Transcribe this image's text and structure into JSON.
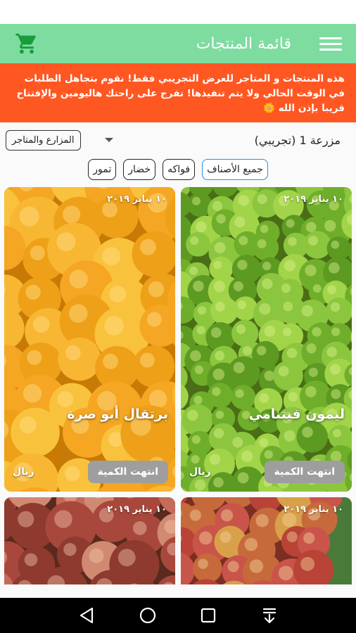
{
  "app_bar": {
    "title": "قائمة المنتجات",
    "cart_icon": "shopping-cart-icon",
    "menu_icon": "hamburger-menu-icon"
  },
  "banner": {
    "text": "هذه المنتجات و المتاجر للعرض التجريبي فقط! نقوم بتجاهل الطلبات في الوقت الحالي ولا يتم تنفيذها! تفرج على راحتك هاليومين والإفتتاح قريبا بإذن الله 🌼",
    "color": "#ff5722"
  },
  "filter": {
    "selected_farm": "مزرعة 1 (تجريبي)",
    "dropdown_label": "المزارع والمتاجر"
  },
  "categories": [
    {
      "label": "جميع الأصناف",
      "active": true
    },
    {
      "label": "فواكه",
      "active": false
    },
    {
      "label": "خضار",
      "active": false
    },
    {
      "label": "تمور",
      "active": false
    }
  ],
  "products": [
    {
      "name": "ليمون فيتنامي",
      "date": "١٠ يناير ٢٠١٩",
      "status": "انتهت الكمية",
      "currency": "ريال",
      "kind": "lime"
    },
    {
      "name": "برتقال أبو صرة",
      "date": "١٠ يناير ٢٠١٩",
      "status": "انتهت الكمية",
      "currency": "ريال",
      "kind": "orange"
    },
    {
      "name": "",
      "date": "١٠ يناير ٢٠١٩",
      "status": "",
      "currency": "",
      "kind": "apple"
    },
    {
      "name": "",
      "date": "١٠ يناير ٢٠١٩",
      "status": "",
      "currency": "",
      "kind": "pomegranate"
    }
  ],
  "nav": {
    "back_icon": "back-triangle-icon",
    "home_icon": "home-circle-icon",
    "recents_icon": "recents-square-icon",
    "notifications_icon": "notifications-down-icon"
  },
  "colors": {
    "app_bar": "#7fdca0",
    "accent": "#2a8fe0",
    "cart_icon": "#1a9b3c",
    "sold_out_button": "#9e9e9e"
  }
}
